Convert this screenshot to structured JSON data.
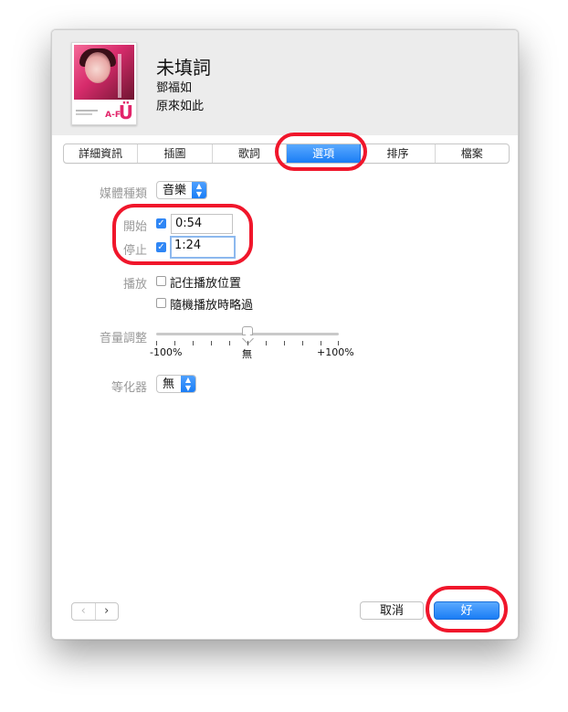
{
  "song": {
    "title": "未填詞",
    "artist": "鄧福如",
    "album": "原來如此",
    "artwork_logo": "A-F",
    "artwork_logo_u": "Ü"
  },
  "tabs": [
    {
      "label": "詳細資訊",
      "active": false
    },
    {
      "label": "插圖",
      "active": false
    },
    {
      "label": "歌詞",
      "active": false
    },
    {
      "label": "選項",
      "active": true
    },
    {
      "label": "排序",
      "active": false
    },
    {
      "label": "檔案",
      "active": false
    }
  ],
  "options": {
    "media_kind_label": "媒體種類",
    "media_kind_value": "音樂",
    "start_label": "開始",
    "start_checked": true,
    "start_value": "0:54",
    "stop_label": "停止",
    "stop_checked": true,
    "stop_value": "1:24",
    "playback_label": "播放",
    "remember_position": {
      "label": "記住播放位置",
      "checked": false
    },
    "skip_shuffle": {
      "label": "隨機播放時略過",
      "checked": false
    },
    "volume_label": "音量調整",
    "volume_min": "-100%",
    "volume_mid": "無",
    "volume_max": "+100%",
    "volume_value": 0,
    "equalizer_label": "等化器",
    "equalizer_value": "無"
  },
  "footer": {
    "prev_label": "‹",
    "next_label": "›",
    "cancel_label": "取消",
    "ok_label": "好"
  },
  "colors": {
    "accent": "#1a7df5",
    "highlight_ring": "#f0162b"
  },
  "icons": {
    "check": "✓",
    "popup_arrows": "updown-arrows-icon"
  }
}
